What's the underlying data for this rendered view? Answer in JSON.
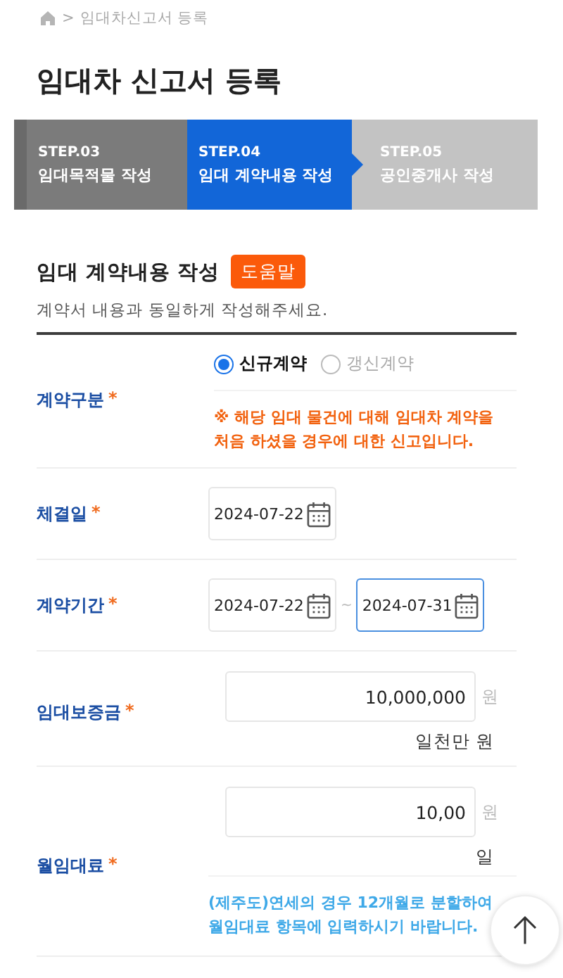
{
  "breadcrumb": {
    "separator": ">",
    "current": "임대차신고서 등록"
  },
  "title": "임대차 신고서 등록",
  "steps": [
    {
      "number": "STEP.03",
      "label": "임대목적물 작성",
      "completed": true,
      "selected": false
    },
    {
      "number": "STEP.04",
      "label": "임대 계약내용 작성",
      "completed": false,
      "selected": true
    },
    {
      "number": "STEP.05",
      "label": "공인중개사 작성",
      "completed": false,
      "selected": false
    }
  ],
  "section": {
    "title": "임대 계약내용 작성",
    "help_button": "도움말",
    "description": "계약서 내용과 동일하게 작성해주세요."
  },
  "rows": [
    {
      "kind": "radio",
      "label": "계약구분",
      "required_mark": "*",
      "options": [
        {
          "label": "신규계약",
          "selected": true
        },
        {
          "label": "갱신계약",
          "selected": false
        }
      ],
      "notice": {
        "kind": "warning",
        "text": "※ 해당 임대 물건에 대해 임대차 계약을 처음 하셨을 경우에 대한 신고입니다."
      }
    },
    {
      "kind": "date",
      "label": "체결일",
      "required_mark": "*",
      "dates": [
        {
          "value": "2024-07-22",
          "focused": false
        }
      ]
    },
    {
      "kind": "date",
      "label": "계약기간",
      "required_mark": "*",
      "separator": "~",
      "dates": [
        {
          "value": "2024-07-22",
          "focused": false
        },
        {
          "value": "2024-07-31",
          "focused": true
        }
      ]
    },
    {
      "kind": "amount",
      "label": "임대보증금",
      "required_mark": "*",
      "value": "10,000,000",
      "unit": "원",
      "in_words": "일천만 원"
    },
    {
      "kind": "amount",
      "label": "월임대료",
      "required_mark": "*",
      "value": "10,00",
      "unit": "원",
      "in_words": "일",
      "notice": {
        "kind": "info",
        "text": "(제주도)연세의 경우 12개월로 분할하여 월임대료 항목에 입력하시기 바랍니다."
      }
    }
  ]
}
